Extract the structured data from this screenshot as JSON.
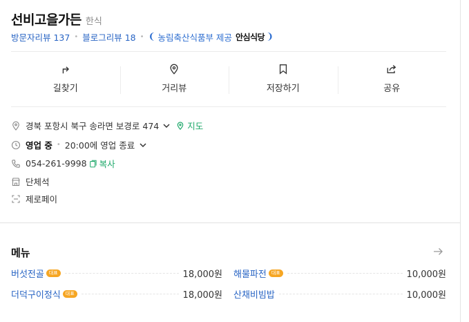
{
  "place": {
    "name": "선비고을가든",
    "category": "한식"
  },
  "reviews": {
    "visitor_label": "방문자리뷰 137",
    "blog_label": "블로그리뷰 18",
    "certification": "농림축산식품부 제공",
    "badge": "안심식당"
  },
  "actions": [
    {
      "label": "길찾기",
      "icon": "directions-icon"
    },
    {
      "label": "거리뷰",
      "icon": "map-pin-icon"
    },
    {
      "label": "저장하기",
      "icon": "bookmark-icon"
    },
    {
      "label": "공유",
      "icon": "share-icon"
    }
  ],
  "info": {
    "address": "경북 포항시 북구 송라면 보경로 474",
    "map_link": "지도",
    "status": "영업 중",
    "hours": "20:00에 영업 종료",
    "phone": "054-261-9998",
    "copy_label": "복사",
    "group_seat": "단체석",
    "zero_pay": "제로페이"
  },
  "menu": {
    "title": "메뉴",
    "badge_label": "대표",
    "items": [
      {
        "name": "버섯전골",
        "price": "18,000원",
        "representative": true
      },
      {
        "name": "해물파전",
        "price": "10,000원",
        "representative": true
      },
      {
        "name": "더덕구이정식",
        "price": "18,000원",
        "representative": true
      },
      {
        "name": "산채비빔밥",
        "price": "10,000원",
        "representative": false
      }
    ]
  },
  "colors": {
    "link_blue": "#2864c4",
    "green": "#1ea86a",
    "badge_orange": "#f6a623"
  }
}
